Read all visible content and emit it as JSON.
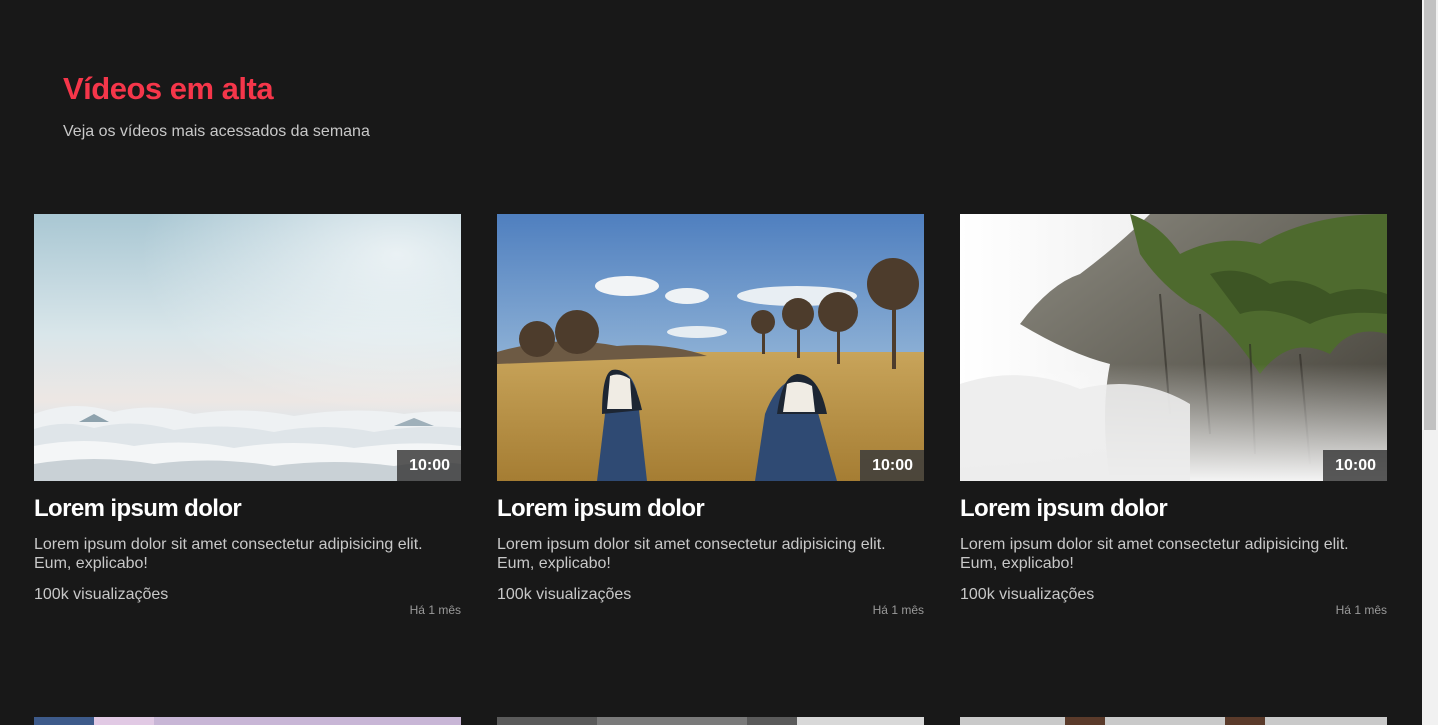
{
  "header": {
    "title": "Vídeos em alta",
    "subtitle": "Veja os vídeos mais acessados da semana"
  },
  "videos": [
    {
      "thumbnail": "clouds-sky-image",
      "duration": "10:00",
      "title": "Lorem ipsum dolor",
      "description": "Lorem ipsum dolor sit amet consectetur adipisicing elit. Eum, explicabo!",
      "views": "100k visualizações",
      "date": "Há 1 mês"
    },
    {
      "thumbnail": "sneakers-field-image",
      "duration": "10:00",
      "title": "Lorem ipsum dolor",
      "description": "Lorem ipsum dolor sit amet consectetur adipisicing elit. Eum, explicabo!",
      "views": "100k visualizações",
      "date": "Há 1 mês"
    },
    {
      "thumbnail": "misty-cliff-image",
      "duration": "10:00",
      "title": "Lorem ipsum dolor",
      "description": "Lorem ipsum dolor sit amet consectetur adipisicing elit. Eum, explicabo!",
      "views": "100k visualizações",
      "date": "Há 1 mês"
    }
  ],
  "colors": {
    "background": "#181818",
    "accent": "#f5364a",
    "title_text": "#ffffff",
    "body_text": "#c8c8c8",
    "muted_text": "#9a9a9a"
  }
}
